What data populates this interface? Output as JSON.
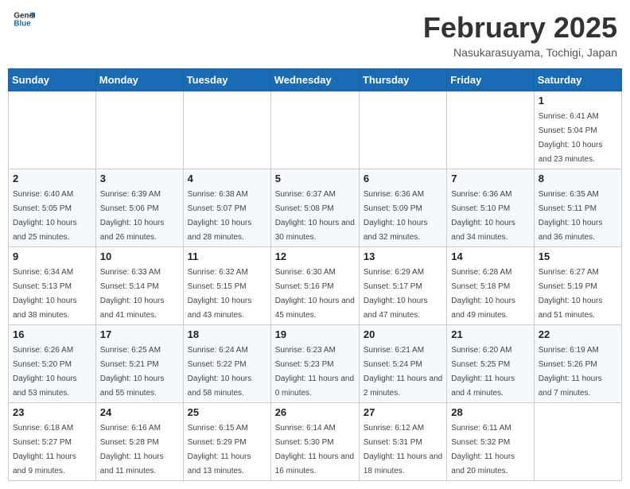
{
  "header": {
    "logo_line1": "General",
    "logo_line2": "Blue",
    "month_title": "February 2025",
    "location": "Nasukarasuyama, Tochigi, Japan"
  },
  "weekdays": [
    "Sunday",
    "Monday",
    "Tuesday",
    "Wednesday",
    "Thursday",
    "Friday",
    "Saturday"
  ],
  "weeks": [
    [
      {
        "day": "",
        "info": ""
      },
      {
        "day": "",
        "info": ""
      },
      {
        "day": "",
        "info": ""
      },
      {
        "day": "",
        "info": ""
      },
      {
        "day": "",
        "info": ""
      },
      {
        "day": "",
        "info": ""
      },
      {
        "day": "1",
        "info": "Sunrise: 6:41 AM\nSunset: 5:04 PM\nDaylight: 10 hours and 23 minutes."
      }
    ],
    [
      {
        "day": "2",
        "info": "Sunrise: 6:40 AM\nSunset: 5:05 PM\nDaylight: 10 hours and 25 minutes."
      },
      {
        "day": "3",
        "info": "Sunrise: 6:39 AM\nSunset: 5:06 PM\nDaylight: 10 hours and 26 minutes."
      },
      {
        "day": "4",
        "info": "Sunrise: 6:38 AM\nSunset: 5:07 PM\nDaylight: 10 hours and 28 minutes."
      },
      {
        "day": "5",
        "info": "Sunrise: 6:37 AM\nSunset: 5:08 PM\nDaylight: 10 hours and 30 minutes."
      },
      {
        "day": "6",
        "info": "Sunrise: 6:36 AM\nSunset: 5:09 PM\nDaylight: 10 hours and 32 minutes."
      },
      {
        "day": "7",
        "info": "Sunrise: 6:36 AM\nSunset: 5:10 PM\nDaylight: 10 hours and 34 minutes."
      },
      {
        "day": "8",
        "info": "Sunrise: 6:35 AM\nSunset: 5:11 PM\nDaylight: 10 hours and 36 minutes."
      }
    ],
    [
      {
        "day": "9",
        "info": "Sunrise: 6:34 AM\nSunset: 5:13 PM\nDaylight: 10 hours and 38 minutes."
      },
      {
        "day": "10",
        "info": "Sunrise: 6:33 AM\nSunset: 5:14 PM\nDaylight: 10 hours and 41 minutes."
      },
      {
        "day": "11",
        "info": "Sunrise: 6:32 AM\nSunset: 5:15 PM\nDaylight: 10 hours and 43 minutes."
      },
      {
        "day": "12",
        "info": "Sunrise: 6:30 AM\nSunset: 5:16 PM\nDaylight: 10 hours and 45 minutes."
      },
      {
        "day": "13",
        "info": "Sunrise: 6:29 AM\nSunset: 5:17 PM\nDaylight: 10 hours and 47 minutes."
      },
      {
        "day": "14",
        "info": "Sunrise: 6:28 AM\nSunset: 5:18 PM\nDaylight: 10 hours and 49 minutes."
      },
      {
        "day": "15",
        "info": "Sunrise: 6:27 AM\nSunset: 5:19 PM\nDaylight: 10 hours and 51 minutes."
      }
    ],
    [
      {
        "day": "16",
        "info": "Sunrise: 6:26 AM\nSunset: 5:20 PM\nDaylight: 10 hours and 53 minutes."
      },
      {
        "day": "17",
        "info": "Sunrise: 6:25 AM\nSunset: 5:21 PM\nDaylight: 10 hours and 55 minutes."
      },
      {
        "day": "18",
        "info": "Sunrise: 6:24 AM\nSunset: 5:22 PM\nDaylight: 10 hours and 58 minutes."
      },
      {
        "day": "19",
        "info": "Sunrise: 6:23 AM\nSunset: 5:23 PM\nDaylight: 11 hours and 0 minutes."
      },
      {
        "day": "20",
        "info": "Sunrise: 6:21 AM\nSunset: 5:24 PM\nDaylight: 11 hours and 2 minutes."
      },
      {
        "day": "21",
        "info": "Sunrise: 6:20 AM\nSunset: 5:25 PM\nDaylight: 11 hours and 4 minutes."
      },
      {
        "day": "22",
        "info": "Sunrise: 6:19 AM\nSunset: 5:26 PM\nDaylight: 11 hours and 7 minutes."
      }
    ],
    [
      {
        "day": "23",
        "info": "Sunrise: 6:18 AM\nSunset: 5:27 PM\nDaylight: 11 hours and 9 minutes."
      },
      {
        "day": "24",
        "info": "Sunrise: 6:16 AM\nSunset: 5:28 PM\nDaylight: 11 hours and 11 minutes."
      },
      {
        "day": "25",
        "info": "Sunrise: 6:15 AM\nSunset: 5:29 PM\nDaylight: 11 hours and 13 minutes."
      },
      {
        "day": "26",
        "info": "Sunrise: 6:14 AM\nSunset: 5:30 PM\nDaylight: 11 hours and 16 minutes."
      },
      {
        "day": "27",
        "info": "Sunrise: 6:12 AM\nSunset: 5:31 PM\nDaylight: 11 hours and 18 minutes."
      },
      {
        "day": "28",
        "info": "Sunrise: 6:11 AM\nSunset: 5:32 PM\nDaylight: 11 hours and 20 minutes."
      },
      {
        "day": "",
        "info": ""
      }
    ]
  ]
}
